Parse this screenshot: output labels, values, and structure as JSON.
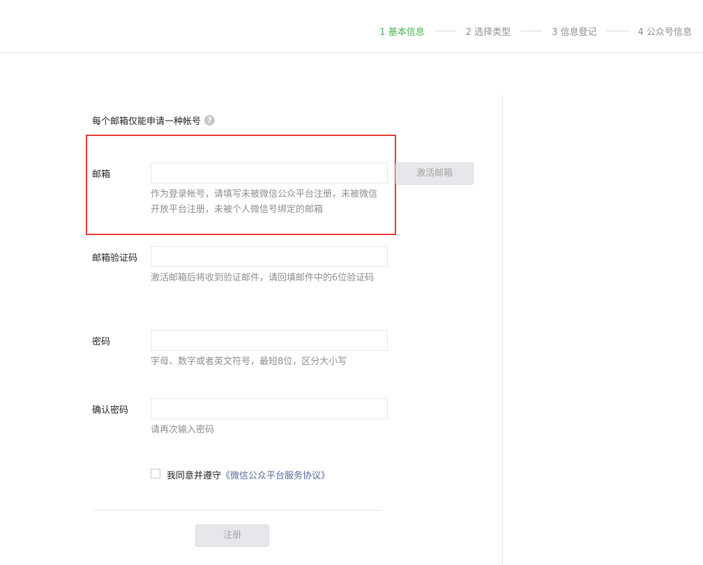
{
  "steps": [
    {
      "label": "1 基本信息",
      "active": true
    },
    {
      "label": "2 选择类型",
      "active": false
    },
    {
      "label": "3 信息登记",
      "active": false
    },
    {
      "label": "4 公众号信息",
      "active": false
    }
  ],
  "notice": {
    "text": "每个邮箱仅能申请一种帐号",
    "help_icon": "?"
  },
  "form": {
    "email": {
      "label": "邮箱",
      "value": "",
      "tip": "作为登录帐号，请填写未被微信公众平台注册，未被微信开放平台注册，未被个人微信号绑定的邮箱",
      "activate_button": "激活邮箱"
    },
    "email_code": {
      "label": "邮箱验证码",
      "value": "",
      "tip": "激活邮箱后将收到验证邮件，请回填邮件中的6位验证码"
    },
    "password": {
      "label": "密码",
      "value": "",
      "tip": "字母、数字或者英文符号，最短8位，区分大小写"
    },
    "confirm_password": {
      "label": "确认密码",
      "value": "",
      "tip": "请再次输入密码"
    },
    "agreement": {
      "checked": false,
      "prefix": "我同意并遵守",
      "link": "《微信公众平台服务协议》"
    },
    "register_button": "注册"
  },
  "colors": {
    "active_step": "#44b549",
    "highlight_border": "#e53935",
    "link": "#576b95"
  }
}
